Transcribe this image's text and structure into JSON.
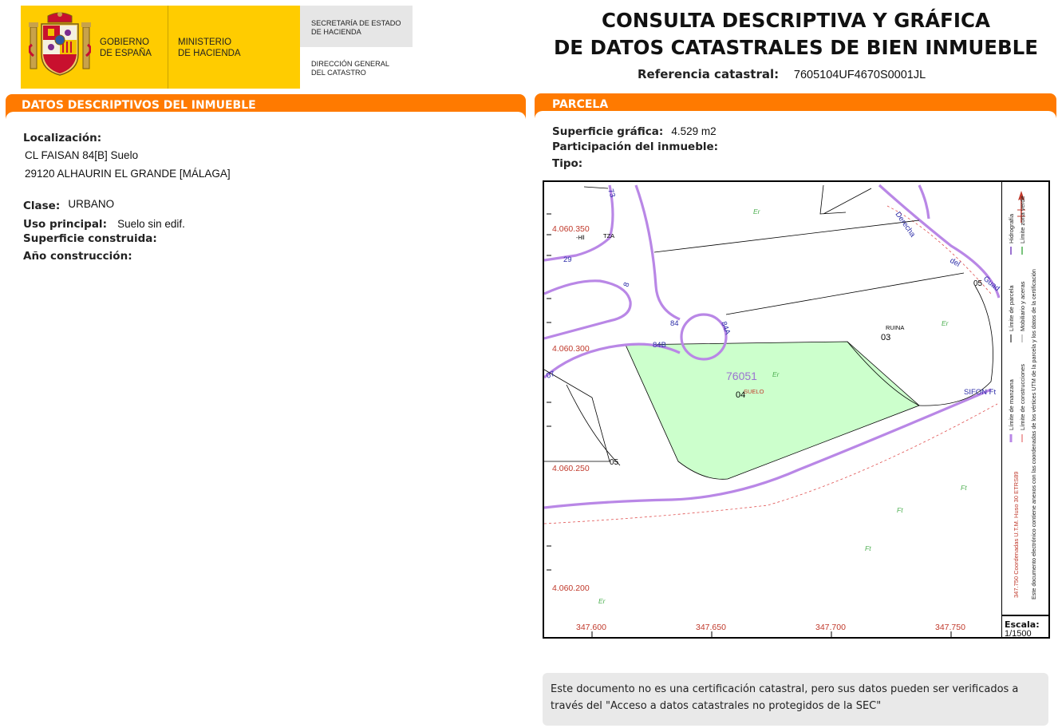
{
  "header": {
    "gov_line1": "GOBIERNO",
    "gov_line2": "DE ESPAÑA",
    "min_line1": "MINISTERIO",
    "min_line2": "DE HACIENDA",
    "sec_line1": "SECRETARÍA DE ESTADO",
    "sec_line2": "DE HACIENDA",
    "dir_line1": "DIRECCIÓN GENERAL",
    "dir_line2": "DEL CATASTRO",
    "title_line1": "CONSULTA DESCRIPTIVA Y GRÁFICA",
    "title_line2": "DE DATOS CATASTRALES DE BIEN INMUEBLE",
    "ref_label": "Referencia catastral:",
    "ref_value": "7605104UF4670S0001JL"
  },
  "colors": {
    "accent_orange": "#ff7a00",
    "logo_yellow": "#ffcc00",
    "parcel_fill": "#ccffcc",
    "manzana_line": "#b987e6",
    "hydro_line": "#e05050"
  },
  "inmueble": {
    "section_title": "DATOS DESCRIPTIVOS DEL INMUEBLE",
    "localizacion_label": "Localización:",
    "address_line1": "CL FAISAN 84[B] Suelo",
    "address_line2": "29120 ALHAURIN EL GRANDE [MÁLAGA]",
    "clase_label": "Clase:",
    "clase_value": "URBANO",
    "uso_label": "Uso principal:",
    "uso_value": "Suelo sin edif.",
    "superficie_label": "Superficie construida:",
    "anio_label": "Año construcción:"
  },
  "parcela": {
    "section_title": "PARCELA",
    "superficie_label": "Superficie gráfica:",
    "superficie_value": "4.529 m2",
    "participacion_label": "Participación del inmueble:",
    "tipo_label": "Tipo:"
  },
  "map": {
    "y_coords": [
      "4.060.350",
      "4.060.300",
      "4.060.250",
      "4.060.200"
    ],
    "x_coords": [
      "347.600",
      "347.650",
      "347.700",
      "347.750"
    ],
    "parcel_number": "76051",
    "parcel_sub": "04",
    "parcel_tag": "SUELO",
    "labels": {
      "ruina": "RUINA",
      "n03": "03",
      "n05a": "05",
      "n05b": "05",
      "tza": "TZA",
      "hll": "-Hll",
      "n29": "29",
      "n73": "73",
      "n8": "8",
      "n84": "84",
      "n84a": "84A",
      "n84b": "84B",
      "n07": "07",
      "derecha": "Derecha",
      "del": "del",
      "guadalquivir": "Guad",
      "sifon": "SIFON Ft",
      "er": "Er",
      "ft": "Ft"
    },
    "legend": {
      "manzana": "Límite de manzana",
      "parcela": "Límite de parcela",
      "hidrografia": "Hidrografía",
      "construcciones": "Límite de construcciones",
      "mobiliario": "Mobiliario y aceras",
      "zona_verde": "Límite zona verde",
      "coords_note": "347.750 Coordenadas U.T.M. Huso 30 ETRS89",
      "doc_note": "Este documento electrónico contiene anexos con las coordenadas de los vértices UTM de la parcela y los datos de la certificación"
    },
    "scale_label": "Escala:",
    "scale_value": "1/1500"
  },
  "notice": {
    "text": "Este documento no es una certificación catastral, pero sus datos pueden ser verificados a través del \"Acceso a datos catastrales no protegidos de la SEC\""
  }
}
